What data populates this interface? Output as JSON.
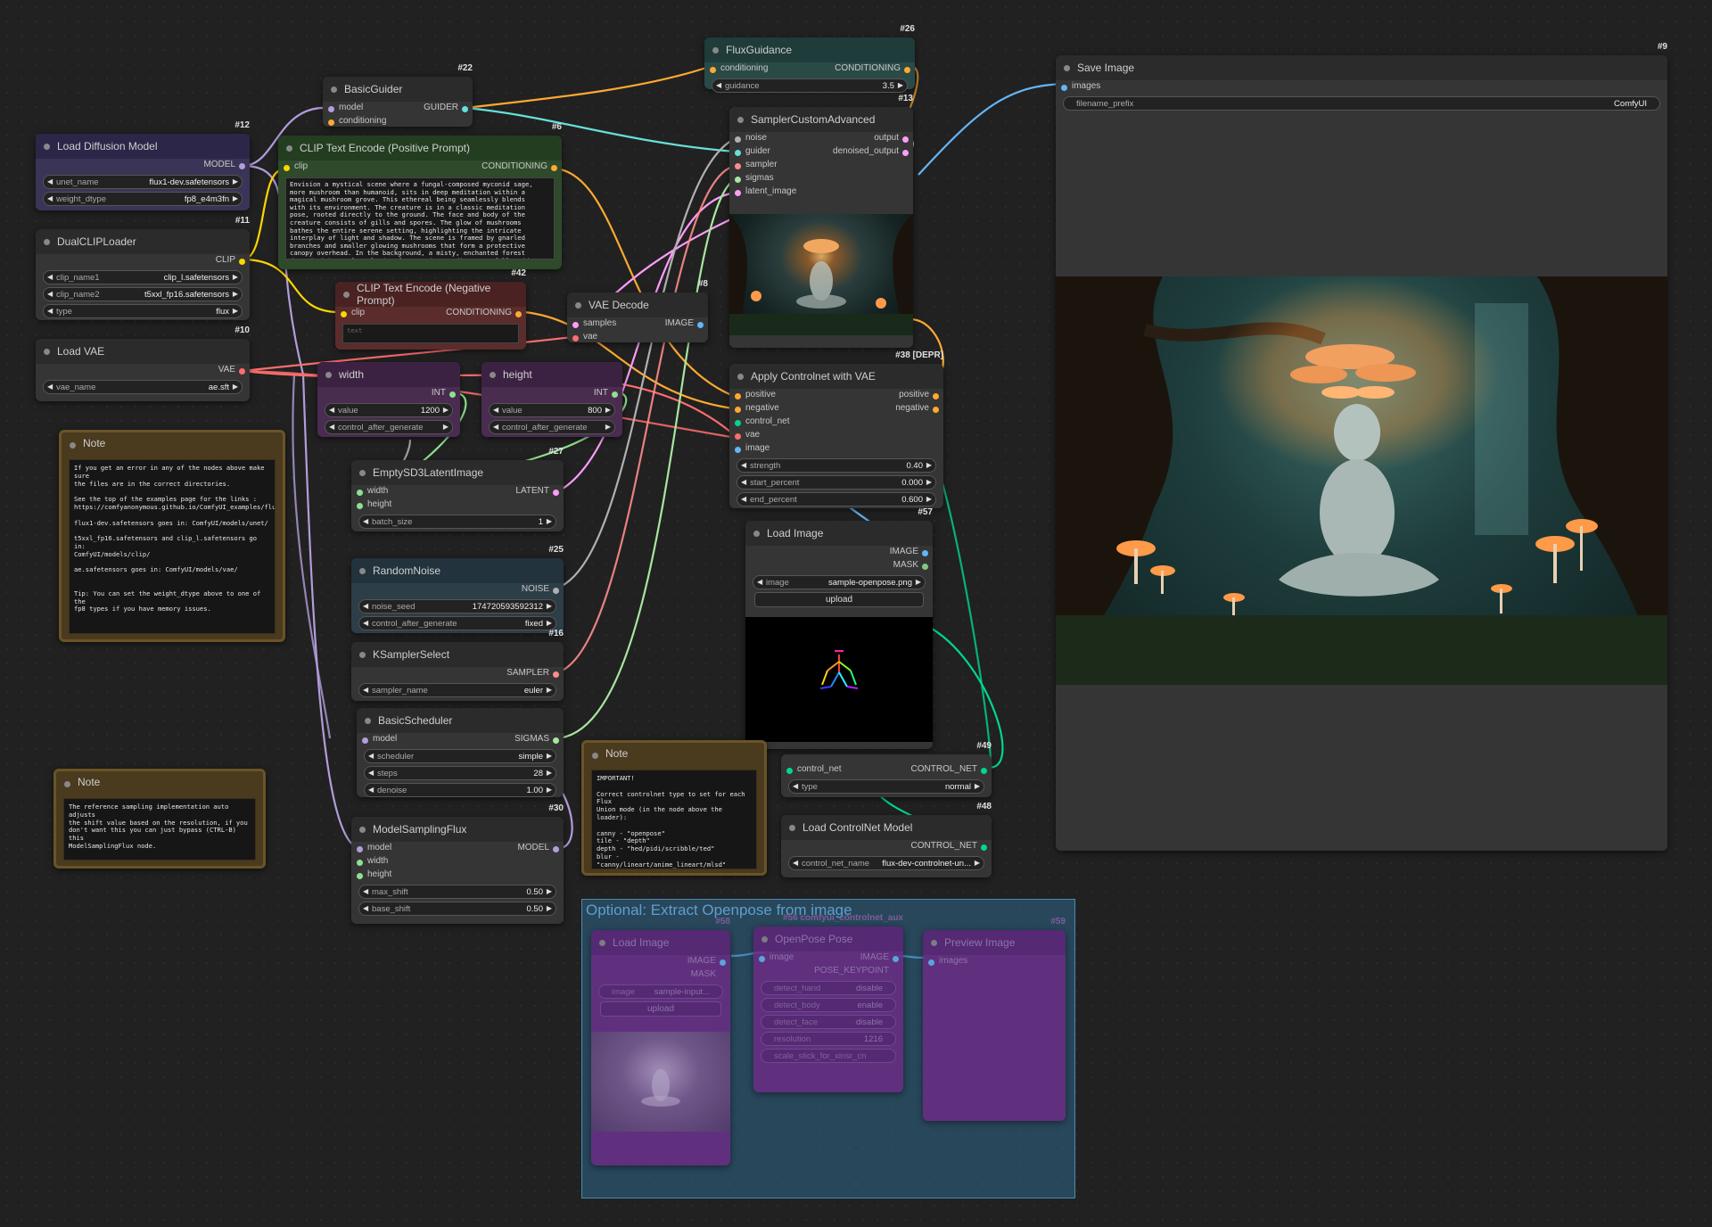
{
  "nodes": {
    "load_diffusion": {
      "id": "#12",
      "title": "Load Diffusion Model",
      "out_model": "MODEL",
      "unet_name_label": "unet_name",
      "unet_name_value": "flux1-dev.safetensors",
      "weight_dtype_label": "weight_dtype",
      "weight_dtype_value": "fp8_e4m3fn"
    },
    "dual_clip": {
      "id": "#11",
      "title": "DualCLIPLoader",
      "out_clip": "CLIP",
      "clip_name1_label": "clip_name1",
      "clip_name1_value": "clip_l.safetensors",
      "clip_name2_label": "clip_name2",
      "clip_name2_value": "t5xxl_fp16.safetensors",
      "type_label": "type",
      "type_value": "flux"
    },
    "load_vae": {
      "id": "#10",
      "title": "Load VAE",
      "out_vae": "VAE",
      "vae_name_label": "vae_name",
      "vae_name_value": "ae.sft"
    },
    "note1": {
      "title": "Note",
      "text": "If you get an error in any of the nodes above make sure\nthe files are in the correct directories.\n\nSee the top of the examples page for the links :\nhttps://comfyanonymous.github.io/ComfyUI_examples/flux/\n\nflux1-dev.safetensors goes in: ComfyUI/models/unet/\n\nt5xxl_fp16.safetensors and clip_l.safetensors go in:\nComfyUI/models/clip/\n\nae.safetensors goes in: ComfyUI/models/vae/\n\n\nTip: You can set the weight_dtype above to one of the\nfp8 types if you have memory issues."
    },
    "note2": {
      "title": "Note",
      "text": "The reference sampling implementation auto adjusts\nthe shift value based on the resolution, if you\ndon't want this you can just bypass (CTRL-B) this\nModelSamplingFlux node."
    },
    "basic_guider": {
      "id": "#22",
      "title": "BasicGuider",
      "in_model": "model",
      "in_conditioning": "conditioning",
      "out_guider": "GUIDER"
    },
    "clip_pos": {
      "id": "#6",
      "title": "CLIP Text Encode (Positive Prompt)",
      "in_clip": "clip",
      "out_cond": "CONDITIONING",
      "text": "Envision a mystical scene where a fungal-composed myconid sage, more mushroom than humanoid, sits in deep meditation within a magical mushroom grove. This ethereal being seamlessly blends with its environment. The creature is in a classic meditation pose, rooted directly to the ground. The face and body of the creature consists of gills and spores. The glow of mushrooms bathes the entire serene setting, highlighting the intricate interplay of light and shadow. The scene is framed by gnarled branches and smaller glowing mushrooms that form a protective canopy overhead. In the background, a misty, enchanted forest dotted with gentle, glowing fauna and cascading waterfalls adds depth and mystique. The ethereal glow"
    },
    "clip_neg": {
      "id": "#42",
      "title": "CLIP Text Encode (Negative Prompt)",
      "in_clip": "clip",
      "out_cond": "CONDITIONING",
      "placeholder": "text"
    },
    "vae_decode": {
      "id": "#8",
      "title": "VAE Decode",
      "in_samples": "samples",
      "in_vae": "vae",
      "out_image": "IMAGE"
    },
    "width": {
      "title": "width",
      "out": "INT",
      "value_label": "value",
      "value": "1200",
      "control_label": "control_after_generate",
      "control_value": ""
    },
    "height": {
      "title": "height",
      "out": "INT",
      "value_label": "value",
      "value": "800",
      "control_label": "control_after_generate",
      "control_value": ""
    },
    "empty_latent": {
      "id": "#27",
      "title": "EmptySD3LatentImage",
      "in_width": "width",
      "in_height": "height",
      "out_latent": "LATENT",
      "batch_label": "batch_size",
      "batch_value": "1"
    },
    "random_noise": {
      "id": "#25",
      "title": "RandomNoise",
      "out_noise": "NOISE",
      "seed_label": "noise_seed",
      "seed_value": "174720593592312",
      "control_label": "control_after_generate",
      "control_value": "fixed"
    },
    "ksampler_select": {
      "id": "#16",
      "title": "KSamplerSelect",
      "out_sampler": "SAMPLER",
      "sampler_label": "sampler_name",
      "sampler_value": "euler"
    },
    "basic_scheduler": {
      "title": "BasicScheduler",
      "in_model": "model",
      "out_sigmas": "SIGMAS",
      "scheduler_label": "scheduler",
      "scheduler_value": "simple",
      "steps_label": "steps",
      "steps_value": "28",
      "denoise_label": "denoise",
      "denoise_value": "1.00"
    },
    "model_sampling": {
      "id": "#30",
      "title": "ModelSamplingFlux",
      "in_model": "model",
      "in_width": "width",
      "in_height": "height",
      "out_model": "MODEL",
      "max_shift_label": "max_shift",
      "max_shift_value": "0.50",
      "base_shift_label": "base_shift",
      "base_shift_value": "0.50"
    },
    "flux_guidance": {
      "id": "#26",
      "title": "FluxGuidance",
      "in_cond": "conditioning",
      "out_cond": "CONDITIONING",
      "guidance_label": "guidance",
      "guidance_value": "3.5"
    },
    "sampler_adv": {
      "id": "#13",
      "title": "SamplerCustomAdvanced",
      "in_noise": "noise",
      "in_guider": "guider",
      "in_sampler": "sampler",
      "in_sigmas": "sigmas",
      "in_latent": "latent_image",
      "out_output": "output",
      "out_denoised": "denoised_output"
    },
    "apply_controlnet": {
      "id": "#38 [DEPR]",
      "title": "Apply Controlnet with VAE",
      "in_positive": "positive",
      "in_negative": "negative",
      "in_control_net": "control_net",
      "in_vae": "vae",
      "in_image": "image",
      "out_positive": "positive",
      "out_negative": "negative",
      "strength_label": "strength",
      "strength_value": "0.40",
      "start_label": "start_percent",
      "start_value": "0.000",
      "end_label": "end_percent",
      "end_value": "0.600"
    },
    "load_image": {
      "id": "#57",
      "title": "Load Image",
      "out_image": "IMAGE",
      "out_mask": "MASK",
      "image_label": "image",
      "image_value": "sample-openpose.png",
      "upload_label": "upload"
    },
    "note3": {
      "title": "Note",
      "text": "IMPORTANT!\n\nCorrect controlnet type to set for each Flux\nUnion mode (in the node above the loader):\n\ncanny - \"openpose\"\ntile - \"depth\"\ndepth - \"hed/pidi/scribble/ted\"\nblur - \"canny/lineart/anime_lineart/mlsd\"\npose - \"normal\"\ngray - \"segment\"\nlow quality - \"tile\""
    },
    "set_union": {
      "id": "#49",
      "in_control_net": "control_net",
      "out": "CONTROL_NET",
      "type_label": "type",
      "type_value": "normal"
    },
    "load_controlnet": {
      "id": "#48",
      "title": "Load ControlNet Model",
      "out": "CONTROL_NET",
      "name_label": "control_net_name",
      "name_value": "flux-dev-controlnet-un..."
    },
    "save_image": {
      "id": "#9",
      "title": "Save Image",
      "in_images": "images",
      "prefix_label": "filename_prefix",
      "prefix_value": "ComfyUI"
    }
  },
  "group": {
    "title": "Optional: Extract Openpose from image",
    "load_image": {
      "id": "#58",
      "title": "Load Image",
      "out_image": "IMAGE",
      "out_mask": "MASK",
      "image_label": "image",
      "image_value": "sample-input...",
      "upload_label": "upload"
    },
    "openpose": {
      "id": "#56 comfyui_controlnet_aux",
      "title": "OpenPose Pose",
      "in_image": "image",
      "out_image": "IMAGE",
      "out_kp": "POSE_KEYPOINT",
      "w1_label": "detect_hand",
      "w1_value": "disable",
      "w2_label": "detect_body",
      "w2_value": "enable",
      "w3_label": "detect_face",
      "w3_value": "disable",
      "w4_label": "resolution",
      "w4_value": "1216",
      "w5_label": "scale_stick_for_xinsr_cn",
      "w5_value": ""
    },
    "preview": {
      "id": "#59",
      "title": "Preview Image",
      "in_images": "images"
    }
  },
  "colors": {
    "canvas": "#212121",
    "node": "#353535",
    "model_wire": "#b39ddb",
    "clip_wire": "#ffd500",
    "vae_wire": "#ff6e6e",
    "cond_wire": "#ffa931",
    "latent_wire": "#ff9cf9",
    "image_wire": "#64b5f6",
    "noise_wire": "#b0b0b0",
    "controlnet_wire": "#00d78d"
  }
}
